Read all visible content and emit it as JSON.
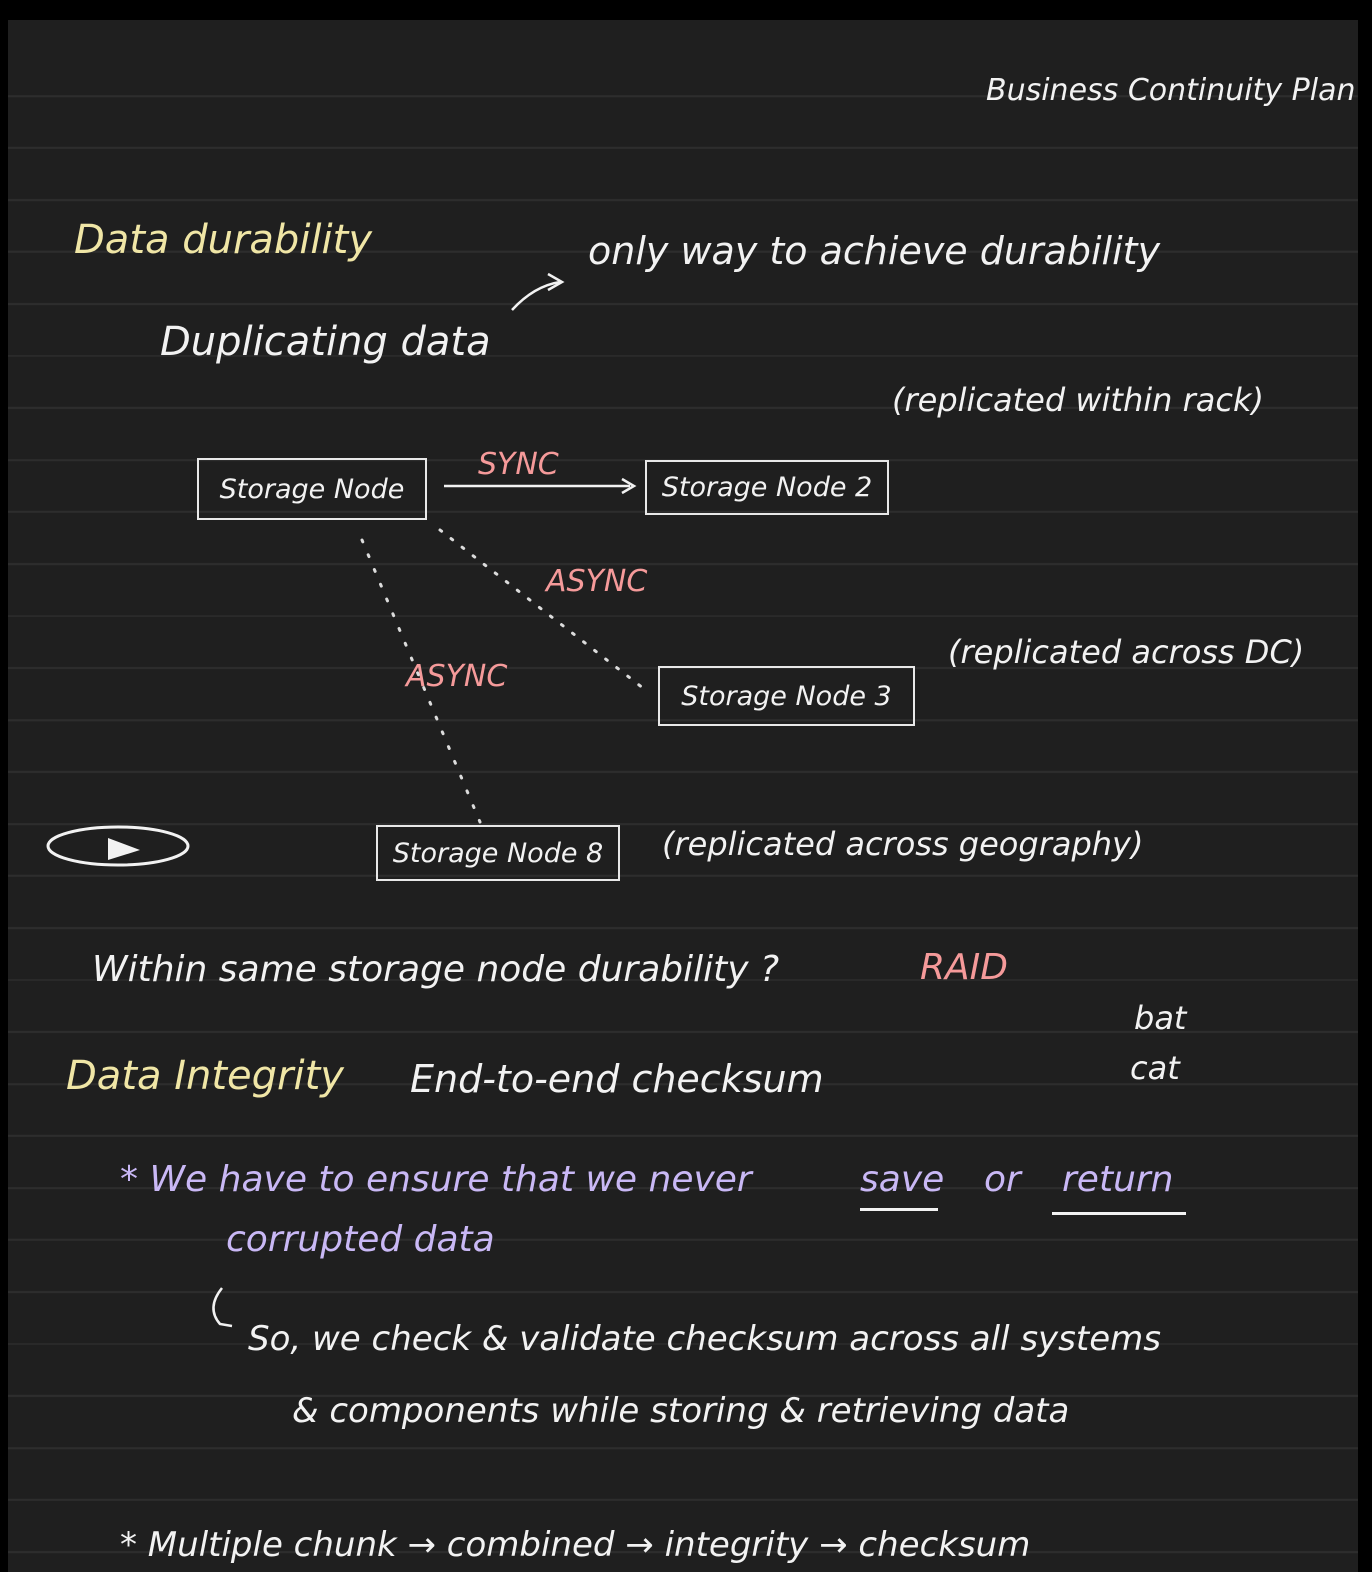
{
  "header": {
    "title": "Business Continuity Plan"
  },
  "durability": {
    "heading": "Data durability",
    "duplicating": "Duplicating data",
    "only_way": "only way to achieve durability",
    "nodes": {
      "node1": "Storage Node",
      "node2": "Storage Node 2",
      "node3": "Storage Node 3",
      "node8": "Storage Node 8"
    },
    "links": {
      "sync": "SYNC",
      "async_dc": "ASYNC",
      "async_geo": "ASYNC"
    },
    "notes": {
      "rack": "(replicated within rack)",
      "dc": "(replicated across DC)",
      "geo": "(replicated across geography)"
    },
    "within_node": "Within same storage node durability ?",
    "raid": "RAID",
    "side_words": [
      "bat",
      "cat"
    ]
  },
  "integrity": {
    "heading": "Data Integrity",
    "method": "End-to-end checksum",
    "bullet1": {
      "lead": "* We have to ensure that we never",
      "save": "save",
      "or": "or",
      "return": "return",
      "line2": "corrupted data"
    },
    "explain_line1": "So, we check & validate checksum across all systems",
    "explain_line2": "& components while storing & retrieving data",
    "bullet2": "* Multiple chunk → combined → integrity → checksum"
  },
  "colors": {
    "background": "#1f1f1f",
    "ruled_line": "#2d2d2d",
    "white_ink": "#f2f2f2",
    "yellow_ink": "#f0e6a6",
    "pink_ink": "#f59a9a",
    "purple_ink": "#c9b8f5"
  },
  "icons": {
    "eye": "eye-icon",
    "hook_arrow": "curved-arrow-icon"
  }
}
